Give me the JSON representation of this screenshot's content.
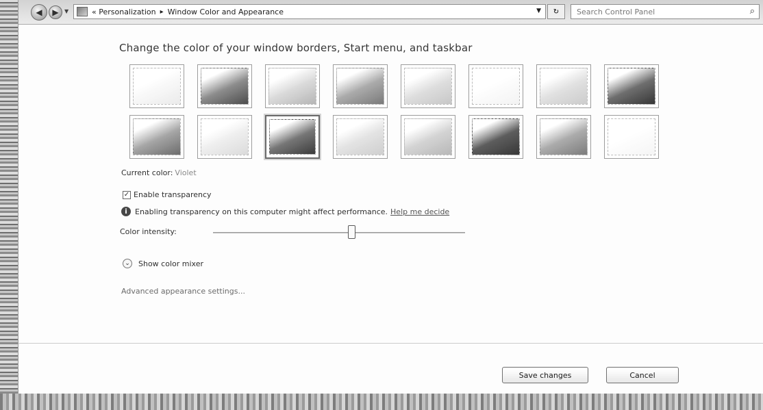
{
  "window": {
    "breadcrumb": [
      "« Personalization",
      "Window Color and Appearance"
    ],
    "search_placeholder": "Search Control Panel"
  },
  "main": {
    "heading": "Change the color of your window borders, Start menu, and taskbar",
    "swatches": [
      {
        "name": "swatch-1",
        "fill": "#f2f2f2",
        "shade": "#e6e6e6"
      },
      {
        "name": "swatch-2",
        "fill": "#8c8c8c",
        "shade": "#4f4f4f"
      },
      {
        "name": "swatch-3",
        "fill": "#d6d6d6",
        "shade": "#b3b3b3"
      },
      {
        "name": "swatch-4",
        "fill": "#a8a8a8",
        "shade": "#7a7a7a"
      },
      {
        "name": "swatch-5",
        "fill": "#dadada",
        "shade": "#c3c3c3"
      },
      {
        "name": "swatch-6",
        "fill": "#f6f6f6",
        "shade": "#ededed"
      },
      {
        "name": "swatch-7",
        "fill": "#dcdcdc",
        "shade": "#c8c8c8"
      },
      {
        "name": "swatch-8",
        "fill": "#6f6f6f",
        "shade": "#3a3a3a"
      },
      {
        "name": "swatch-9",
        "fill": "#a3a3a3",
        "shade": "#6e6e6e"
      },
      {
        "name": "swatch-10",
        "fill": "#e9e9e9",
        "shade": "#d6d6d6"
      },
      {
        "name": "swatch-11",
        "fill": "#777777",
        "shade": "#3f3f3f"
      },
      {
        "name": "swatch-12",
        "fill": "#dedede",
        "shade": "#cbcbcb"
      },
      {
        "name": "swatch-13",
        "fill": "#cfcfcf",
        "shade": "#b5b5b5"
      },
      {
        "name": "swatch-14",
        "fill": "#5f5f5f",
        "shade": "#3b3b3b"
      },
      {
        "name": "swatch-15",
        "fill": "#a9a9a9",
        "shade": "#7c7c7c"
      },
      {
        "name": "swatch-16",
        "fill": "#f7f7f7",
        "shade": "#efefef"
      }
    ],
    "selected_swatch_index": 10,
    "current_color_label": "Current color:",
    "current_color_value": "Violet",
    "enable_transparency_label": "Enable transparency",
    "enable_transparency_checked": true,
    "transparency_info": "Enabling transparency on this computer might affect performance.",
    "help_link": "Help me decide",
    "color_intensity_label": "Color intensity:",
    "color_intensity_fraction": 0.55,
    "show_color_mixer_label": "Show color mixer",
    "advanced_link": "Advanced appearance settings..."
  },
  "buttons": {
    "save": "Save changes",
    "cancel": "Cancel"
  }
}
